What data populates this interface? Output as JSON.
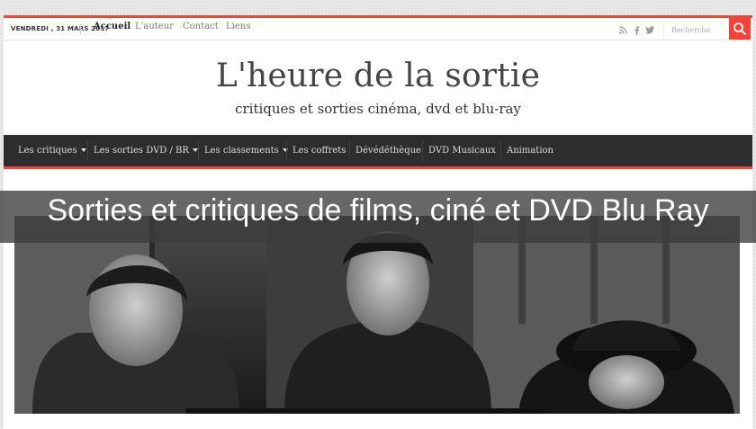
{
  "topbar": {
    "date": "VENDREDI , 31 MARS 2017",
    "nav": [
      {
        "label": "Accueil",
        "active": true
      },
      {
        "label": "L'auteur",
        "active": false
      },
      {
        "label": "Contact",
        "active": false
      },
      {
        "label": "Liens",
        "active": false
      }
    ],
    "social_icons": [
      "rss-icon",
      "facebook-icon",
      "twitter-icon"
    ],
    "search": {
      "placeholder": "Recherche",
      "icon": "search-icon"
    },
    "accent": "#f44336"
  },
  "header": {
    "title": "L'heure de la sortie",
    "tagline": "critiques et sorties cinéma, dvd et blu-ray"
  },
  "mainnav": {
    "items": [
      {
        "label": "Les critiques",
        "dropdown": true
      },
      {
        "label": "Les sorties DVD / BR",
        "dropdown": true
      },
      {
        "label": "Les classements",
        "dropdown": true
      },
      {
        "label": "Les coffrets",
        "dropdown": false
      },
      {
        "label": "Dévédéthèque",
        "dropdown": false
      },
      {
        "label": "DVD Musicaux",
        "dropdown": false
      },
      {
        "label": "Animation",
        "dropdown": false
      }
    ],
    "background": "#2d2d2d"
  },
  "banner": {
    "text": "Sorties et critiques de films, ciné et DVD Blu Ray"
  },
  "hero": {
    "image": "black-and-white-film-still"
  }
}
